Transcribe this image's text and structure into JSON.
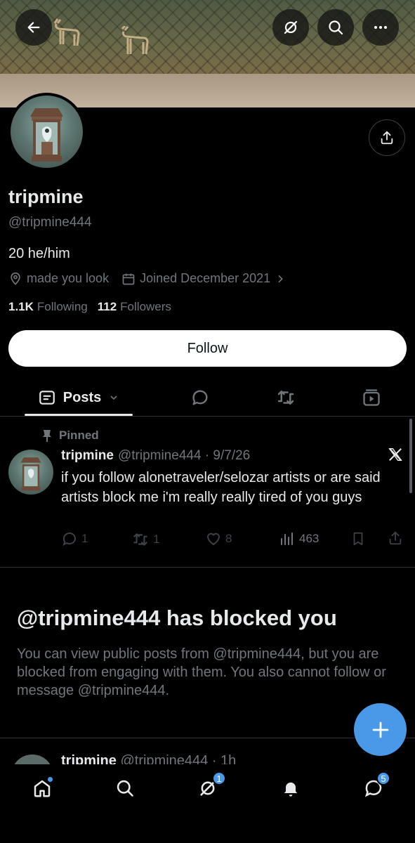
{
  "profile": {
    "name": "tripmine",
    "handle": "@tripmine444",
    "bio": "20 he/him",
    "location": "made you look",
    "joined": "Joined December 2021",
    "following_count": "1.1K",
    "following_label": "Following",
    "followers_count": "112",
    "followers_label": "Followers"
  },
  "actions": {
    "follow_label": "Follow"
  },
  "tabs": {
    "posts_label": "Posts"
  },
  "pinned_post": {
    "pinned_label": "Pinned",
    "author": "tripmine",
    "handle_date": "@tripmine444 · 9/7/26",
    "text": "if you follow alonetraveler/selozar artists or are said artists block me i'm really really tired of you guys",
    "replies": "1",
    "reposts": "1",
    "likes": "8",
    "views": "463"
  },
  "blocked": {
    "title": "@tripmine444 has blocked you",
    "text": "You can view public posts from @tripmine444, but you are blocked from engaging with them. You also cannot follow or message @tripmine444."
  },
  "next_post": {
    "author": "tripmine",
    "handle_time": "@tripmine444 · 1h"
  },
  "bottom_nav": {
    "grok_badge": "1",
    "messages_badge": "5"
  },
  "colors": {
    "accent": "#4a99e9",
    "muted": "#71767b",
    "text": "#e7e9ea",
    "background": "#000000"
  },
  "icons": [
    "back-arrow-icon",
    "grok-icon",
    "search-icon",
    "more-icon",
    "share-icon",
    "location-icon",
    "calendar-icon",
    "chevron-right-icon",
    "posts-icon",
    "chevron-down-icon",
    "replies-tab-icon",
    "reposts-tab-icon",
    "media-tab-icon",
    "pin-icon",
    "x-logo-icon",
    "reply-icon",
    "repost-icon",
    "like-icon",
    "views-icon",
    "bookmark-icon",
    "plus-icon",
    "home-icon",
    "bell-icon",
    "messages-icon"
  ]
}
